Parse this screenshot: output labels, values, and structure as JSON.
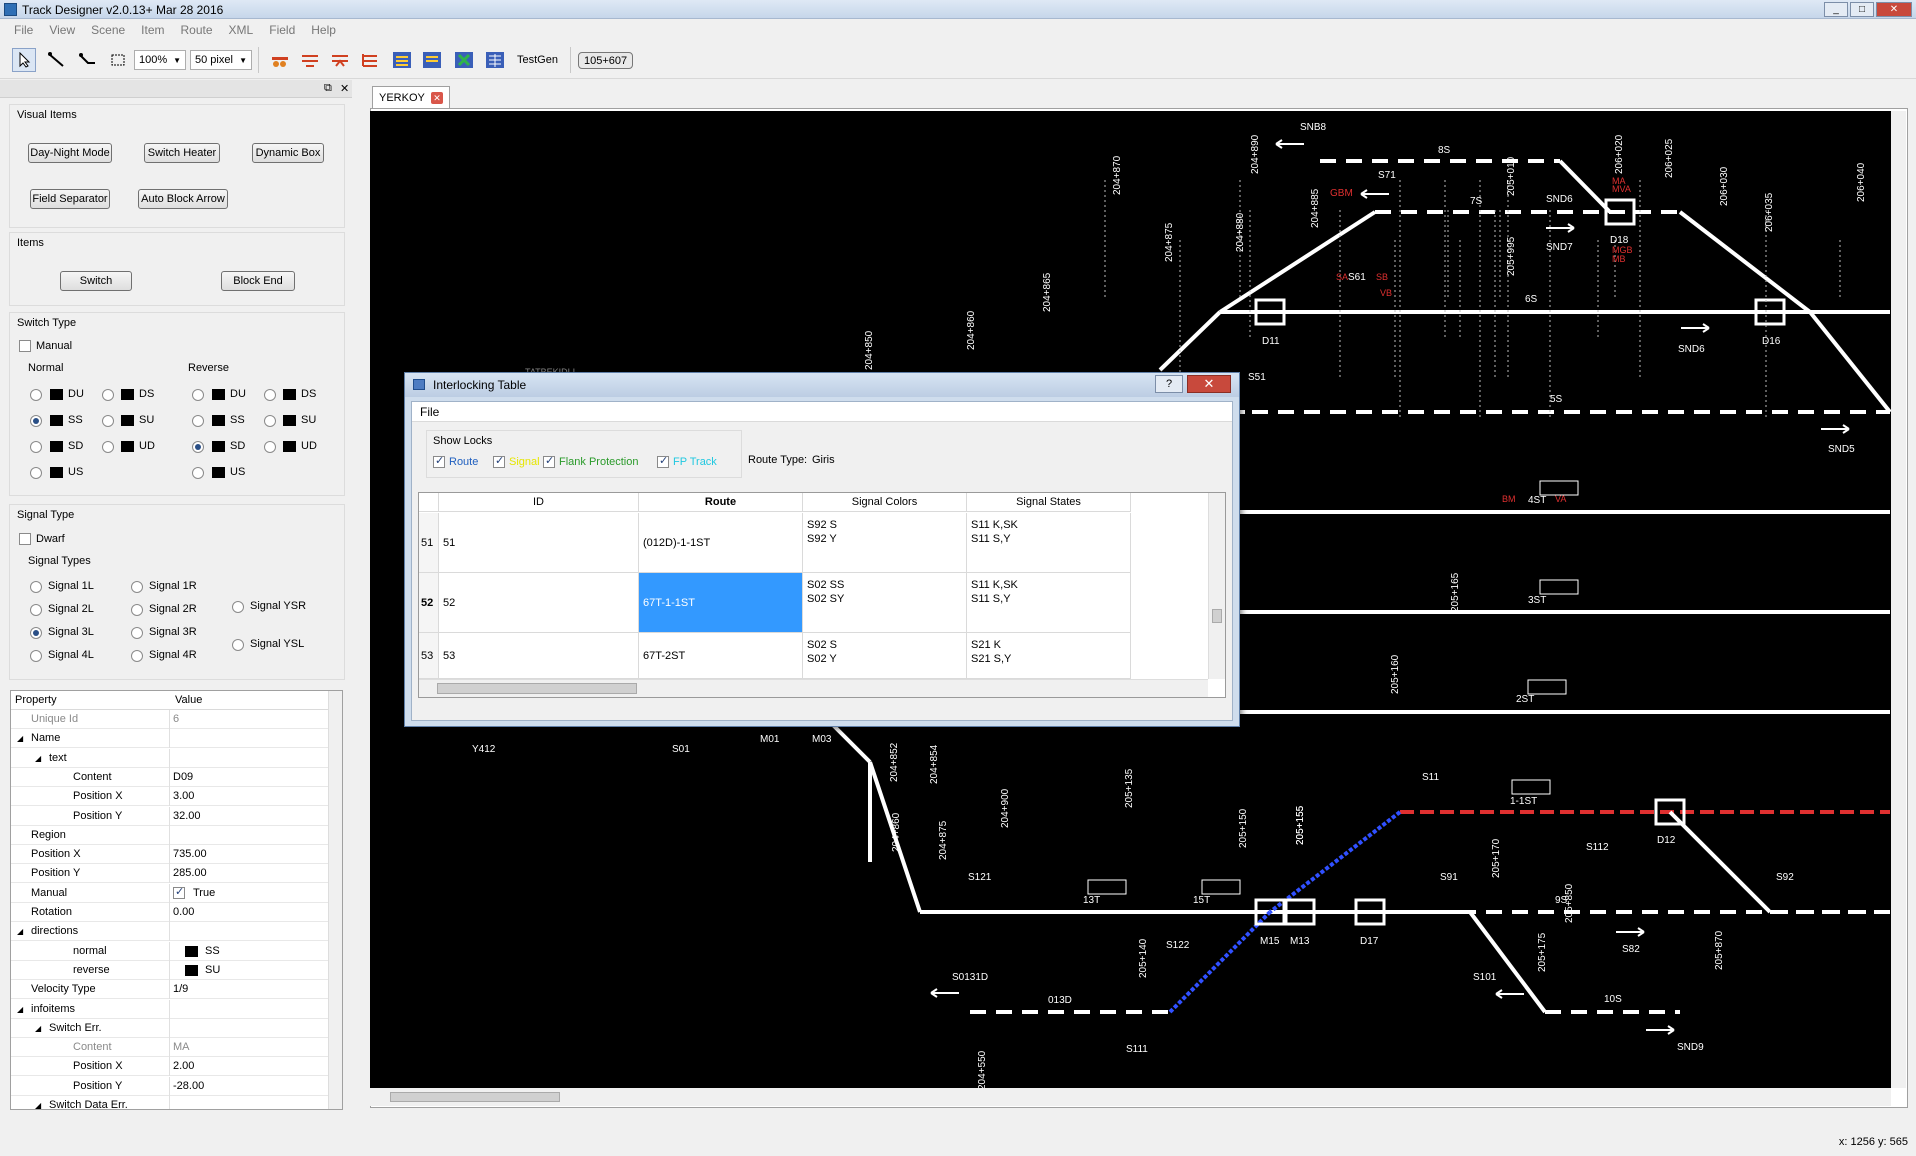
{
  "window": {
    "title": "Track Designer v2.0.13+ Mar 28 2016",
    "min": "_",
    "max": "□",
    "close": "✕"
  },
  "menu": [
    "File",
    "View",
    "Scene",
    "Item",
    "Route",
    "XML",
    "Field",
    "Help"
  ],
  "toolbar": {
    "zoom": "100%",
    "grid": "50 pixel",
    "testgen": "TestGen",
    "coord": "105+607"
  },
  "dock": {
    "float": "⧉",
    "close": "✕"
  },
  "visual_items": {
    "title": "Visual Items",
    "buttons": [
      "Day-Night Mode",
      "Switch Heater",
      "Dynamic Box",
      "Field Separator",
      "Auto Block Arrow"
    ]
  },
  "items": {
    "title": "Items",
    "buttons": [
      "Switch",
      "Block End"
    ]
  },
  "switch_type": {
    "title": "Switch Type",
    "manual": "Manual",
    "normal_title": "Normal",
    "reverse_title": "Reverse",
    "normal": [
      "DU",
      "DS",
      "SS",
      "SU",
      "SD",
      "UD",
      "US"
    ],
    "reverse": [
      "DU",
      "DS",
      "SS",
      "SU",
      "SD",
      "UD",
      "US"
    ]
  },
  "signal_type": {
    "title": "Signal Type",
    "dwarf": "Dwarf",
    "types_title": "Signal Types",
    "types": [
      "Signal 1L",
      "Signal 1R",
      "Signal 2L",
      "Signal 2R",
      "Signal 3L",
      "Signal 3R",
      "Signal 4L",
      "Signal 4R",
      "Signal YSR",
      "Signal YSL"
    ]
  },
  "properties": {
    "headers": [
      "Property",
      "Value"
    ],
    "rows": [
      {
        "k": "Unique Id",
        "v": "6"
      },
      {
        "k": "Name",
        "v": ""
      },
      {
        "k": "text",
        "v": ""
      },
      {
        "k": "Content",
        "v": "D09"
      },
      {
        "k": "Position X",
        "v": "3.00"
      },
      {
        "k": "Position Y",
        "v": "32.00"
      },
      {
        "k": "Region",
        "v": ""
      },
      {
        "k": "Position X",
        "v": "735.00"
      },
      {
        "k": "Position Y",
        "v": "285.00"
      },
      {
        "k": "Manual",
        "v": "True"
      },
      {
        "k": "Rotation",
        "v": "0.00"
      },
      {
        "k": "directions",
        "v": ""
      },
      {
        "k": "normal",
        "v": "SS"
      },
      {
        "k": "reverse",
        "v": "SU"
      },
      {
        "k": "Velocity Type",
        "v": "1/9"
      },
      {
        "k": "infoitems",
        "v": ""
      },
      {
        "k": "Switch Err.",
        "v": ""
      },
      {
        "k": "Content",
        "v": "MA"
      },
      {
        "k": "Position X",
        "v": "2.00"
      },
      {
        "k": "Position Y",
        "v": "-28.00"
      },
      {
        "k": "Switch Data Err.",
        "v": ""
      }
    ]
  },
  "tab": {
    "label": "YERKOY"
  },
  "dialog": {
    "title": "Interlocking Table",
    "help": "?",
    "close": "✕",
    "menu": "File",
    "show_locks": "Show Locks",
    "locks": [
      {
        "label": "Route",
        "color": "#1f5fbf"
      },
      {
        "label": "Signal",
        "color": "#e6e600"
      },
      {
        "label": "Flank Protection",
        "color": "#2a9a2a"
      },
      {
        "label": "FP Track",
        "color": "#20c8e0"
      }
    ],
    "route_type_label": "Route Type:",
    "route_type_value": "Giris",
    "columns": [
      "ID",
      "Route",
      "Signal Colors",
      "Signal States"
    ],
    "rows": [
      {
        "n": "51",
        "id": "51",
        "route": "(012D)-1-1ST",
        "colors": "S92 S\nS92 Y",
        "states": "S11 K,SK\nS11 S,Y"
      },
      {
        "n": "52",
        "id": "52",
        "route": "67T-1-1ST",
        "colors": "S02 SS\nS02 SY",
        "states": "S11 K,SK\nS11 S,Y"
      },
      {
        "n": "53",
        "id": "53",
        "route": "67T-2ST",
        "colors": "S02 S\nS02 Y",
        "states": "S21 K\nS21 S,Y"
      }
    ]
  },
  "status": {
    "coords": "x: 1256 y: 565"
  },
  "schematic": {
    "labels": [
      "SNB8",
      "8S",
      "204+890",
      "204+885",
      "204+880",
      "204+875",
      "204+870",
      "204+865",
      "204+860",
      "204+850",
      "S71",
      "GBM",
      "7S",
      "SND6",
      "SND7",
      "205+010",
      "205+995",
      "206+020",
      "206+025",
      "206+030",
      "206+035",
      "206+040",
      "MA",
      "MVA",
      "D18",
      "MGB",
      "MB",
      "6S",
      "S61",
      "SA",
      "SB",
      "VB",
      "D11",
      "D16",
      "SND6",
      "S51",
      "5S",
      "SND5",
      "205+165",
      "205+160",
      "4ST",
      "3ST",
      "2ST",
      "1-1ST",
      "BM",
      "VA",
      "S11",
      "D12",
      "S112",
      "S92",
      "9S",
      "S82",
      "13T",
      "15T",
      "S121",
      "S122",
      "M15",
      "M13",
      "D17",
      "S91",
      "S101",
      "10S",
      "SND9",
      "013D",
      "S0131D",
      "S111",
      "M01",
      "M03",
      "S01",
      "Y412",
      "204+852",
      "204+854",
      "204+860",
      "204+875",
      "204+900",
      "205+135",
      "205+140",
      "205+150",
      "205+155",
      "205+170",
      "205+175",
      "205+850",
      "205+870",
      "205+155",
      "204+550",
      "TATBEKIDLI"
    ]
  }
}
